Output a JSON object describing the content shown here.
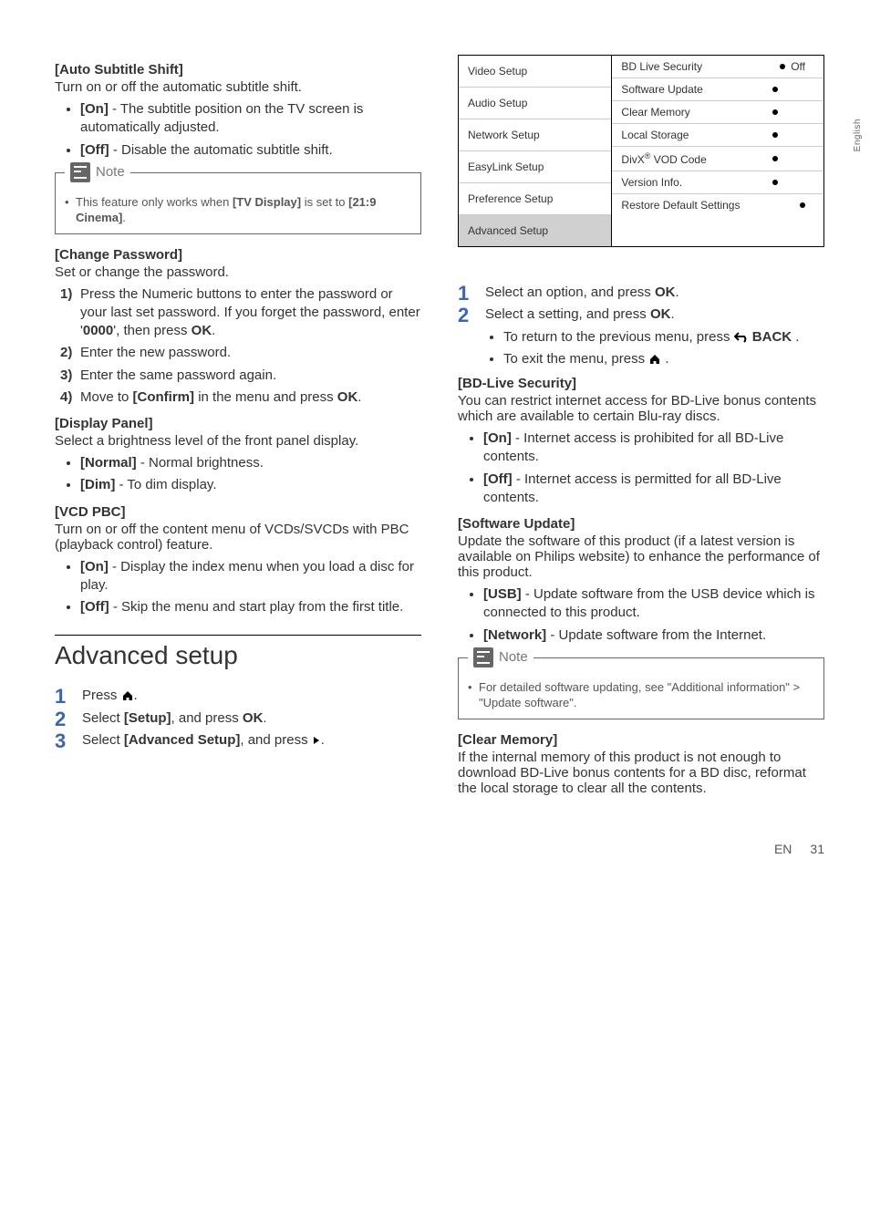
{
  "side_tab": "English",
  "left": {
    "auto_subtitle": {
      "title": "[Auto Subtitle Shift]",
      "desc": "Turn on or off the automatic subtitle shift.",
      "on_label": "[On]",
      "on_desc": " - The subtitle position on the TV screen is automatically adjusted.",
      "off_label": "[Off]",
      "off_desc": " - Disable the automatic subtitle shift."
    },
    "note1": {
      "label": "Note",
      "text_before": "This feature only works when ",
      "tv_display": "[TV Display]",
      "text_mid": " is set to ",
      "cinema": "[21:9 Cinema]",
      "text_after": "."
    },
    "change_pw": {
      "title": "[Change Password]",
      "desc": "Set or change the password.",
      "step1_a": "Press the Numeric buttons to enter the password or your last set password. If you forget the password, enter '",
      "step1_code": "0000",
      "step1_b": "', then press ",
      "ok": "OK",
      "step2": "Enter the new password.",
      "step3": "Enter the same password again.",
      "step4_a": "Move to ",
      "confirm": "[Confirm]",
      "step4_b": " in the menu and press "
    },
    "display_panel": {
      "title": "[Display Panel]",
      "desc": "Select a brightness level of the front panel display.",
      "normal_label": "[Normal]",
      "normal_desc": " - Normal brightness.",
      "dim_label": "[Dim]",
      "dim_desc": " - To dim display."
    },
    "vcd": {
      "title": "[VCD PBC]",
      "desc": "Turn on or off the content menu of VCDs/SVCDs with PBC (playback control) feature.",
      "on_label": "[On]",
      "on_desc": " - Display the index menu when you load a disc for play.",
      "off_label": "[Off]",
      "off_desc": " - Skip the menu and start play from the first title."
    },
    "advanced_heading": "Advanced setup",
    "steps_a": {
      "step1": "Press ",
      "step2_a": "Select ",
      "setup": "[Setup]",
      "step2_b": ", and press ",
      "ok": "OK",
      "step3_a": "Select ",
      "advanced": "[Advanced Setup]",
      "step3_b": ", and press "
    }
  },
  "menu": {
    "left_items": [
      "Video Setup",
      "Audio Setup",
      "Network Setup",
      "EasyLink Setup",
      "Preference Setup",
      "Advanced Setup"
    ],
    "right_items": [
      {
        "label": "BD Live Security",
        "value": "Off"
      },
      {
        "label": "Software Update",
        "value": ""
      },
      {
        "label": "Clear Memory",
        "value": ""
      },
      {
        "label": "Local Storage",
        "value": ""
      },
      {
        "label": "DivX",
        "sup": "®",
        "label2": " VOD Code",
        "value": ""
      },
      {
        "label": "Version Info.",
        "value": ""
      },
      {
        "label": "Restore Default Settings",
        "value": ""
      }
    ]
  },
  "right": {
    "step4": "Select an option, and press ",
    "step5": "Select a setting, and press ",
    "ok": "OK",
    "sub1_a": "To return to the previous menu, press",
    "back": " BACK",
    "sub2": "To exit the menu, press",
    "bd_live": {
      "title": "[BD-Live Security]",
      "desc": "You can restrict internet access for BD-Live bonus contents which are available to certain Blu-ray discs.",
      "on_label": "[On]",
      "on_desc": " - Internet access is prohibited for all BD-Live contents.",
      "off_label": "[Off]",
      "off_desc": " - Internet access is permitted for all BD-Live contents."
    },
    "software": {
      "title": "[Software Update]",
      "desc": "Update the software of this product (if a latest version is available on Philips website) to enhance the performance of this product.",
      "usb_label": "[USB]",
      "usb_desc": " - Update software from the USB device which is connected to this product.",
      "net_label": "[Network]",
      "net_desc": " - Update software from the Internet."
    },
    "note2": {
      "label": "Note",
      "text": "For detailed software updating, see \"Additional information\" > \"Update software\"."
    },
    "clear": {
      "title": "[Clear Memory]",
      "desc": "If the internal memory of this product is not enough to download BD-Live bonus contents for a BD disc, reformat the local storage to clear all the contents."
    }
  },
  "footer": {
    "lang": "EN",
    "page": "31"
  }
}
